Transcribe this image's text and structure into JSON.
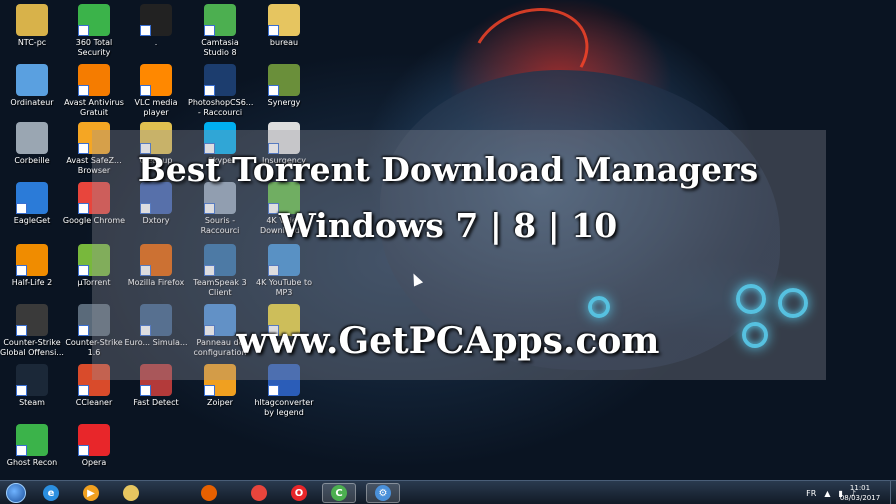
{
  "overlay": {
    "line1": "Best Torrent Download Managers",
    "line2": "Windows 7 | 8 | 10",
    "line3": "www.GetPCApps.com"
  },
  "desktop_icons": [
    {
      "label": "NTC-pc",
      "icon": "folder-user-icon",
      "color": "#d8b24a"
    },
    {
      "label": "360 Total Security",
      "icon": "360-security-icon",
      "color": "#3bb34a"
    },
    {
      "label": ".",
      "icon": "mask-icon",
      "color": "#222222"
    },
    {
      "label": "Camtasia Studio 8",
      "icon": "camtasia-icon",
      "color": "#4caf50"
    },
    {
      "label": "bureau",
      "icon": "folder-icon",
      "color": "#e6c560"
    },
    {
      "label": "Ordinateur",
      "icon": "computer-icon",
      "color": "#5aa0e0"
    },
    {
      "label": "Avast Antivirus Gratuit",
      "icon": "avast-icon",
      "color": "#f57c00"
    },
    {
      "label": "VLC media player",
      "icon": "vlc-icon",
      "color": "#ff8800"
    },
    {
      "label": "PhotoshopCS6... - Raccourci",
      "icon": "photoshop-icon",
      "color": "#1c3d6e"
    },
    {
      "label": "Synergy",
      "icon": "synergy-icon",
      "color": "#6a8f3a"
    },
    {
      "label": "Corbeille",
      "icon": "recycle-bin-icon",
      "color": "#9aa6b2"
    },
    {
      "label": "Avast SafeZ... Browser",
      "icon": "avast-safezone-icon",
      "color": "#f5a623"
    },
    {
      "label": "Cleanup",
      "icon": "cleanup-icon",
      "color": "#e0c050"
    },
    {
      "label": "Skype",
      "icon": "skype-icon",
      "color": "#00aff0"
    },
    {
      "label": "Insurgency",
      "icon": "insurgency-icon",
      "color": "#dddddd"
    },
    {
      "label": "EagleGet",
      "icon": "eagleget-icon",
      "color": "#2b7bd8"
    },
    {
      "label": "Google Chrome",
      "icon": "chrome-icon",
      "color": "#e8453c"
    },
    {
      "label": "Dxtory",
      "icon": "dxtory-icon",
      "color": "#3a5fb0"
    },
    {
      "label": "Souris - Raccourci",
      "icon": "mouse-icon",
      "color": "#8fa3b8"
    },
    {
      "label": "4K Video Downloader",
      "icon": "4k-video-downloader-icon",
      "color": "#5fba46"
    },
    {
      "label": "Half-Life 2",
      "icon": "half-life-icon",
      "color": "#f08c00"
    },
    {
      "label": "µTorrent",
      "icon": "utorrent-icon",
      "color": "#78b83c"
    },
    {
      "label": "Mozilla Firefox",
      "icon": "firefox-icon",
      "color": "#e66000"
    },
    {
      "label": "TeamSpeak 3 Client",
      "icon": "teamspeak-icon",
      "color": "#2c6ea8"
    },
    {
      "label": "4K YouTube to MP3",
      "icon": "4k-youtube-mp3-icon",
      "color": "#3d8fd6"
    },
    {
      "label": "Counter-Strike Global Offensi...",
      "icon": "csgo-icon",
      "color": "#3a3a3a"
    },
    {
      "label": "Counter-Strike 1.6",
      "icon": "counter-strike-icon",
      "color": "#5a6a7a"
    },
    {
      "label": "Euro... Simula...",
      "icon": "euro-truck-icon",
      "color": "#3a5f8a"
    },
    {
      "label": "Panneau de configuration",
      "icon": "control-panel-icon",
      "color": "#4a90d9"
    },
    {
      "label": "Fraps",
      "icon": "fraps-icon",
      "color": "#e8d23a"
    },
    {
      "label": "Steam",
      "icon": "steam-icon",
      "color": "#1b2838"
    },
    {
      "label": "CCleaner",
      "icon": "ccleaner-icon",
      "color": "#d94b2b"
    },
    {
      "label": "Fast Detect",
      "icon": "fast-detect-icon",
      "color": "#b33a3a"
    },
    {
      "label": "Zoiper",
      "icon": "zoiper-icon",
      "color": "#f0a020"
    },
    {
      "label": "hltagconverter by legend",
      "icon": "hltag-converter-icon",
      "color": "#2b5db8"
    },
    {
      "label": "Ghost Recon",
      "icon": "ghost-recon-icon",
      "color": "#3bb34a"
    },
    {
      "label": "Opera",
      "icon": "opera-icon",
      "color": "#e8262a"
    }
  ],
  "taskbar": {
    "pinned": [
      {
        "name": "internet-explorer",
        "icon": "internet-explorer-icon",
        "color": "#2b8fe0",
        "glyph": "e"
      },
      {
        "name": "media-player",
        "icon": "media-player-icon",
        "color": "#f0a020",
        "glyph": "▶"
      },
      {
        "name": "file-explorer",
        "icon": "folder-icon",
        "color": "#e6c560",
        "glyph": ""
      },
      {
        "name": "firefox",
        "icon": "firefox-icon",
        "color": "#e66000",
        "glyph": ""
      },
      {
        "name": "chrome",
        "icon": "chrome-icon",
        "color": "#e8453c",
        "glyph": ""
      },
      {
        "name": "opera",
        "icon": "opera-icon",
        "color": "#e8262a",
        "glyph": "O"
      },
      {
        "name": "camtasia",
        "icon": "camtasia-icon",
        "color": "#4caf50",
        "glyph": "C"
      },
      {
        "name": "settings-app",
        "icon": "gear-icon",
        "color": "#4a90d9",
        "glyph": "⚙"
      }
    ],
    "tray": {
      "language": "FR",
      "time": "11:01",
      "date": "08/03/2017"
    }
  }
}
